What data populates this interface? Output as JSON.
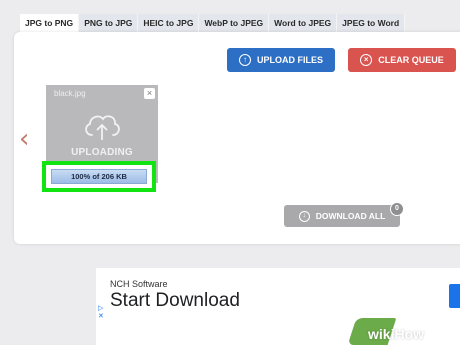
{
  "tabs": [
    {
      "label": "JPG to PNG",
      "active": true
    },
    {
      "label": "PNG to JPG",
      "active": false
    },
    {
      "label": "HEIC to JPG",
      "active": false
    },
    {
      "label": "WebP to JPEG",
      "active": false
    },
    {
      "label": "Word to JPEG",
      "active": false
    },
    {
      "label": "JPEG to Word",
      "active": false
    }
  ],
  "toolbar": {
    "upload_label": "UPLOAD FILES",
    "upload_icon": "arrow-up-circle-icon",
    "clear_label": "CLEAR QUEUE",
    "clear_icon": "x-circle-icon",
    "upload_color": "#2d6fc4",
    "clear_color": "#d9534f"
  },
  "file": {
    "name": "black.jpg",
    "status": "UPLOADING",
    "progress_text": "100% of 206 KB",
    "progress_percent": 100,
    "highlight_color": "#12e312"
  },
  "download": {
    "label": "DOWNLOAD ALL",
    "count": "0"
  },
  "ad": {
    "advertiser": "NCH Software",
    "headline": "Start Download"
  },
  "watermark": {
    "text": "wikiHow"
  }
}
